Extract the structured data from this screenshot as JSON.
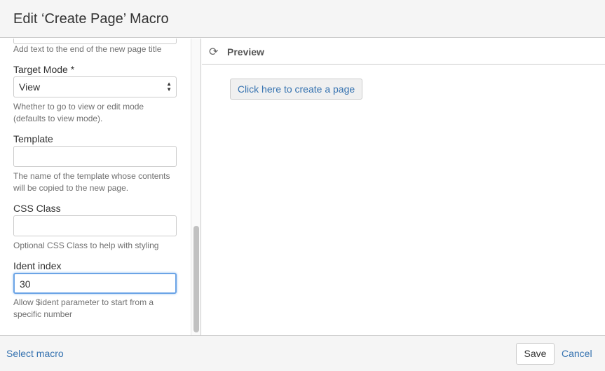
{
  "dialog": {
    "title": "Edit ‘Create Page’ Macro"
  },
  "form": {
    "title_suffix_desc": "Add text to the end of the new page title",
    "target_mode": {
      "label": "Target Mode *",
      "value": "View",
      "desc": "Whether to go to view or edit mode (defaults to view mode)."
    },
    "template": {
      "label": "Template",
      "value": "",
      "desc": "The name of the template whose contents will be copied to the new page."
    },
    "css_class": {
      "label": "CSS Class",
      "value": "",
      "desc": "Optional CSS Class to help with styling"
    },
    "ident_index": {
      "label": "Ident index",
      "value": "30",
      "desc": "Allow $ident parameter to start from a specific number"
    }
  },
  "preview": {
    "title": "Preview",
    "icon": "refresh-icon",
    "button": "Click here to create a page"
  },
  "footer": {
    "select_macro": "Select macro",
    "save": "Save",
    "cancel": "Cancel"
  }
}
